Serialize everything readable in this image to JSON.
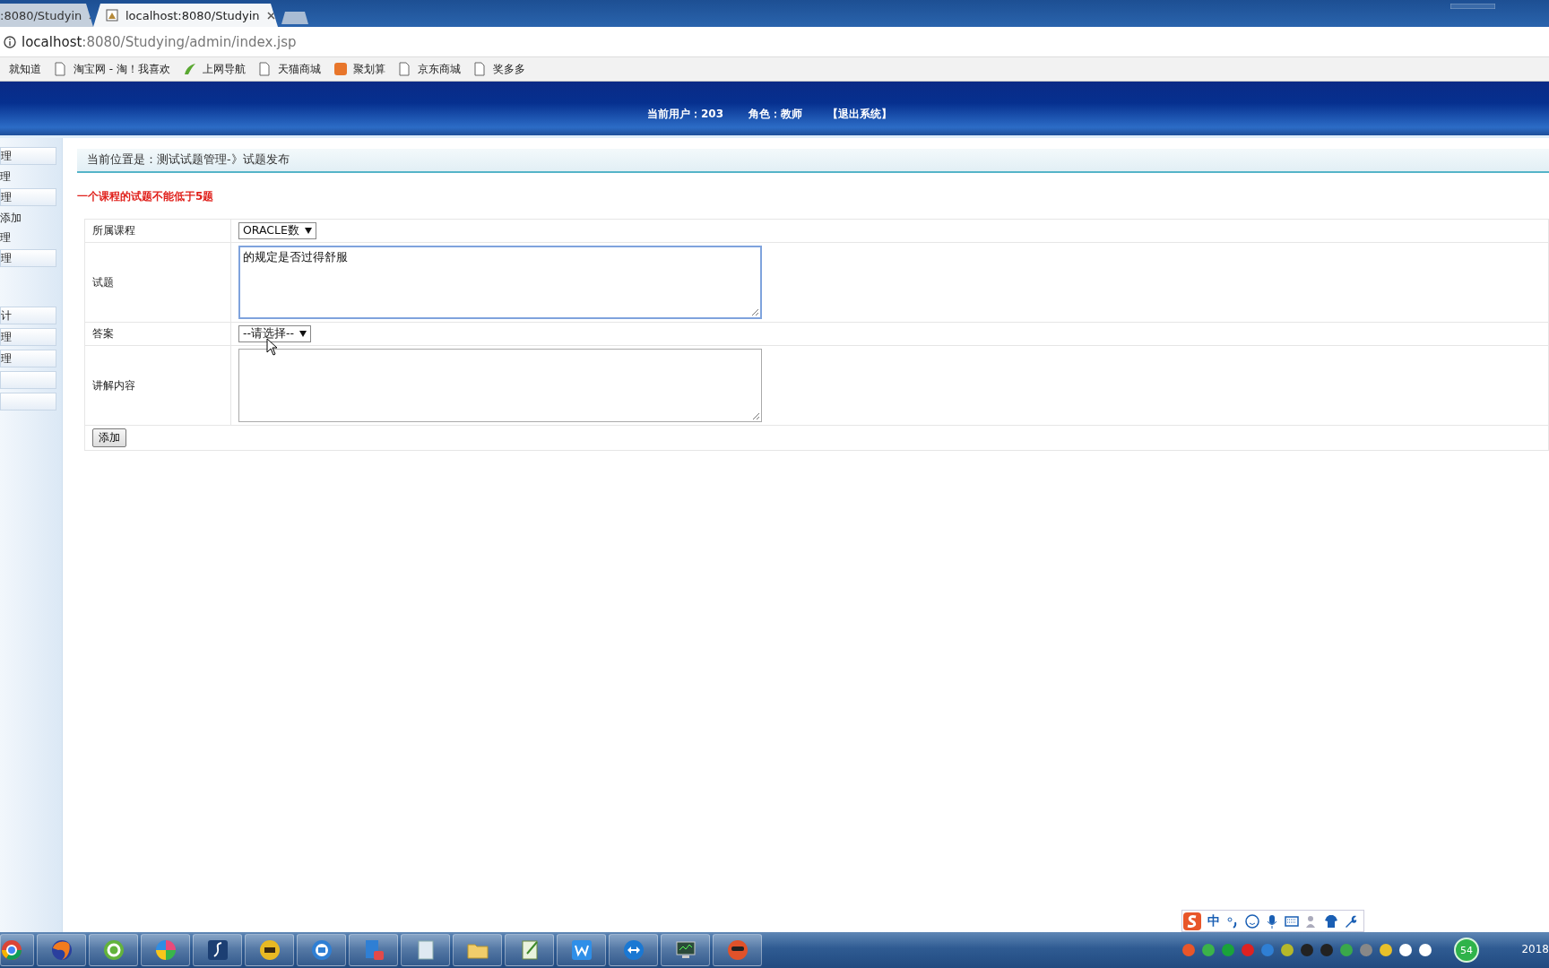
{
  "browser": {
    "tabs": [
      {
        "title": ":8080/Studyin",
        "selected": false
      },
      {
        "title": "localhost:8080/Studyin",
        "selected": true
      }
    ],
    "address": {
      "host": "localhost",
      "rest": ":8080/Studying/admin/index.jsp"
    },
    "bookmarks": [
      {
        "label": "就知道",
        "kind": "plain"
      },
      {
        "label": "淘宝网 - 淘！我喜欢",
        "kind": "page"
      },
      {
        "label": "上网导航",
        "kind": "leaf"
      },
      {
        "label": "天猫商城",
        "kind": "page"
      },
      {
        "label": "聚划算",
        "kind": "badge"
      },
      {
        "label": "京东商城",
        "kind": "page"
      },
      {
        "label": "奖多多",
        "kind": "page"
      }
    ]
  },
  "header": {
    "user": "当前用户：203",
    "role": "角色：教师",
    "logout": "【退出系统】"
  },
  "sidebar": {
    "items": [
      {
        "kind": "button",
        "label": "理"
      },
      {
        "kind": "text",
        "label": "理"
      },
      {
        "kind": "button",
        "label": "理"
      },
      {
        "kind": "text",
        "label": "添加"
      },
      {
        "kind": "text",
        "label": "理"
      },
      {
        "kind": "button",
        "label": "理"
      },
      {
        "kind": "gap"
      },
      {
        "kind": "button",
        "label": "计"
      },
      {
        "kind": "button",
        "label": "理"
      },
      {
        "kind": "button",
        "label": "理"
      },
      {
        "kind": "button"
      },
      {
        "kind": "button"
      }
    ]
  },
  "breadcrumb": "当前位置是：测试试题管理-》试题发布",
  "notice": "一个课程的试题不能低于5题",
  "form": {
    "rows": [
      {
        "label": "所属课程",
        "kind": "select",
        "value": "ORACLE数"
      },
      {
        "label": "试题",
        "kind": "textarea",
        "value": "的规定是否过得舒服",
        "focused": true
      },
      {
        "label": "答案",
        "kind": "select",
        "value": "--请选择--"
      },
      {
        "label": "讲解内容",
        "kind": "textarea",
        "focused": false
      }
    ],
    "submit": "添加"
  },
  "ime": {
    "mode": "中"
  },
  "taskbar": {
    "badge": "54",
    "clock": "2018"
  }
}
